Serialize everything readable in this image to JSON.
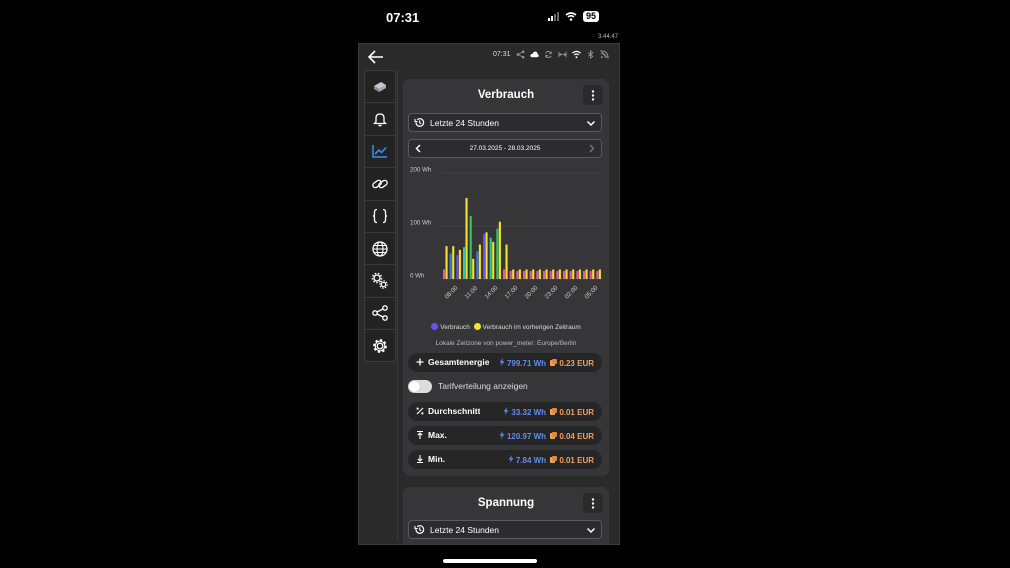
{
  "status_bar": {
    "time": "07:31",
    "battery": "95"
  },
  "version": "3.44.47",
  "app_bar": {
    "time": "07:31"
  },
  "rail": [
    {
      "icon": "device-icon"
    },
    {
      "icon": "bell-icon"
    },
    {
      "icon": "chart-icon",
      "active": true
    },
    {
      "icon": "link-icon"
    },
    {
      "icon": "braces-icon"
    },
    {
      "icon": "globe-icon"
    },
    {
      "icon": "gears-icon"
    },
    {
      "icon": "share-icon"
    },
    {
      "icon": "settings-icon"
    }
  ],
  "card1": {
    "title": "Verbrauch",
    "range_select": "Letzte 24 Stunden",
    "date_range": "27.03.2025 - 28.03.2025",
    "legend_current": "Verbrauch",
    "legend_previous": "Verbrauch im vorherigen Zeitraum",
    "timezone_note": "Lokale Zeitzone von power_meter: Europe/Berlin",
    "total": {
      "label": "Gesamtenergie",
      "wh": "799.71 Wh",
      "eur": "0.23 EUR"
    },
    "toggle_label": "Tarifverteilung anzeigen",
    "toggle_on": false,
    "average": {
      "label": "Durchschnitt",
      "wh": "33.32 Wh",
      "eur": "0.01 EUR"
    },
    "max": {
      "label": "Max.",
      "wh": "120.97 Wh",
      "eur": "0.04 EUR"
    },
    "min": {
      "label": "Min.",
      "wh": "7.84 Wh",
      "eur": "0.01 EUR"
    }
  },
  "card2": {
    "title": "Spannung",
    "range_select": "Letzte 24 Stunden"
  },
  "colors": {
    "current": "#6c4ff0",
    "previous": "#f5e22a",
    "accent": "#2f7fe0"
  },
  "chart_data": {
    "type": "bar",
    "y_tick_labels": [
      "0 Wh",
      "100 Wh",
      "200 Wh"
    ],
    "ylim": [
      0,
      200
    ],
    "x_tick_labels": [
      "08:00",
      "11:00",
      "14:00",
      "17:00",
      "20:00",
      "23:00",
      "02:00",
      "05:00"
    ],
    "series": [
      {
        "name": "Verbrauch",
        "values": [
          18,
          48,
          45,
          60,
          119,
          52,
          85,
          78,
          95,
          18,
          15,
          15,
          15,
          15,
          15,
          15,
          15,
          15,
          15,
          15,
          15,
          15,
          15,
          15
        ]
      },
      {
        "name": "Verbrauch im vorherigen Zeitraum",
        "values": [
          62,
          62,
          55,
          153,
          38,
          65,
          88,
          70,
          108,
          65,
          18,
          18,
          18,
          18,
          18,
          18,
          18,
          18,
          18,
          18,
          18,
          18,
          18,
          18
        ]
      }
    ]
  }
}
